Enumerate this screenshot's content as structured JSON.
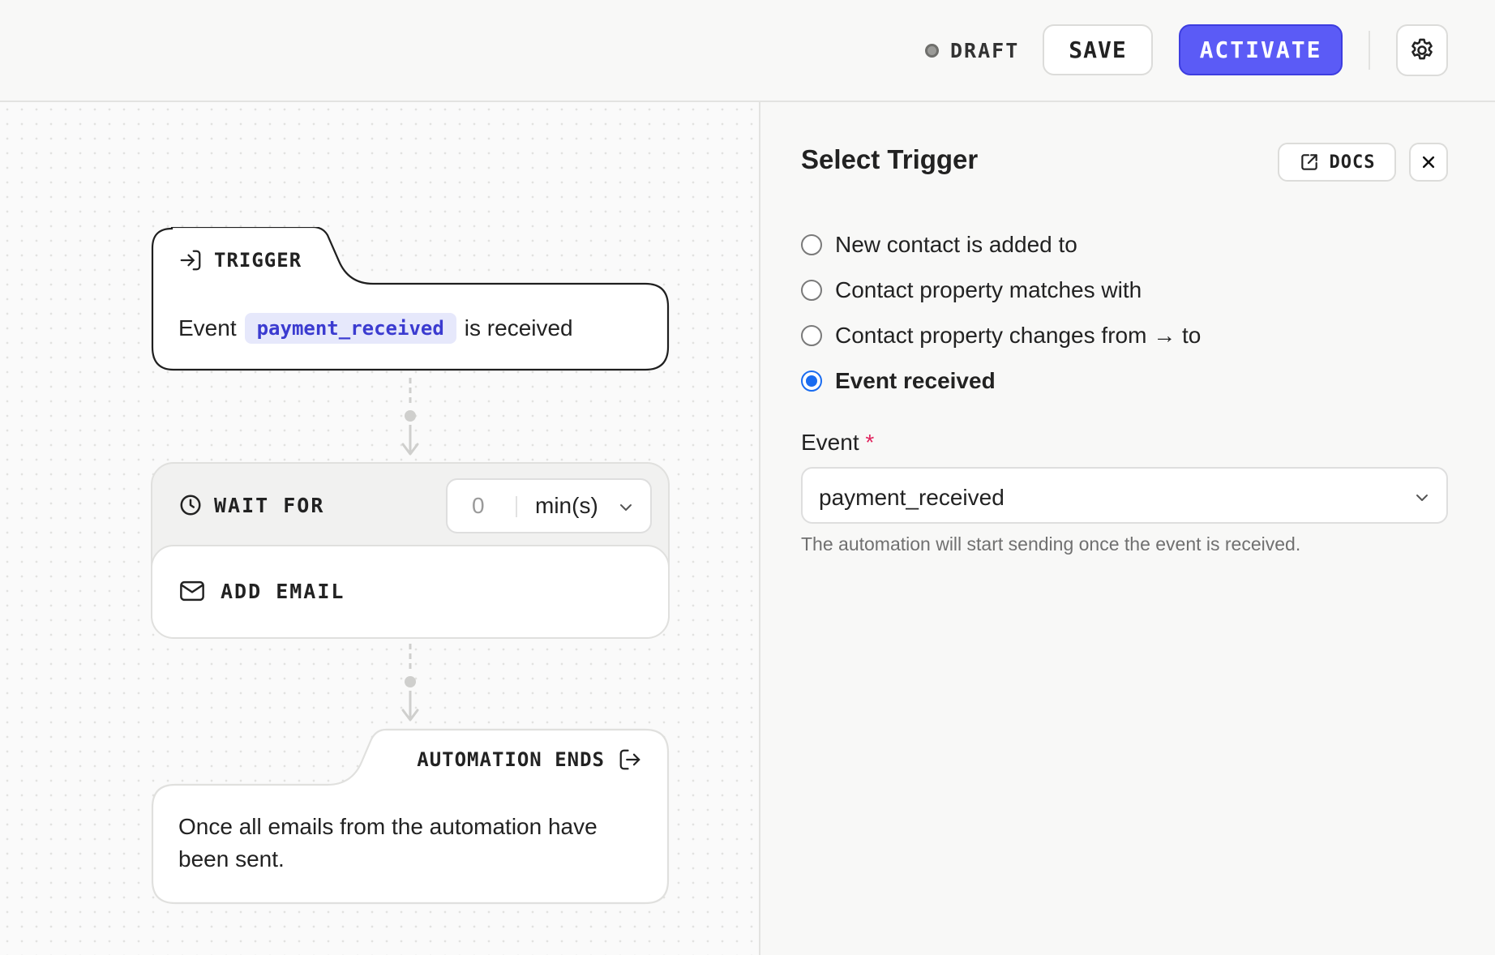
{
  "topbar": {
    "status": "DRAFT",
    "save_label": "SAVE",
    "activate_label": "ACTIVATE"
  },
  "flow": {
    "trigger": {
      "title": "TRIGGER",
      "prefix": "Event",
      "event_name": "payment_received",
      "suffix": "is received"
    },
    "wait": {
      "title": "WAIT FOR",
      "value": "0",
      "unit": "min(s)"
    },
    "email": {
      "title": "ADD EMAIL"
    },
    "end": {
      "title": "AUTOMATION ENDS",
      "description": "Once all emails from the automation have been sent."
    }
  },
  "panel": {
    "title": "Select Trigger",
    "docs_label": "DOCS",
    "options": [
      {
        "label": "New contact is added to",
        "selected": false
      },
      {
        "label": "Contact property matches with",
        "selected": false
      },
      {
        "label": "Contact property changes from → to",
        "selected": false
      },
      {
        "label": "Event received",
        "selected": true
      }
    ],
    "event_field": {
      "label": "Event",
      "required_mark": "*",
      "value": "payment_received",
      "helper": "The automation will start sending once the event is received."
    }
  },
  "colors": {
    "accent": "#5b5bf6",
    "radio_selected": "#1a6cf0",
    "pill_bg": "#e6e8fb",
    "pill_text": "#3b3bd0",
    "required": "#e0245e"
  }
}
